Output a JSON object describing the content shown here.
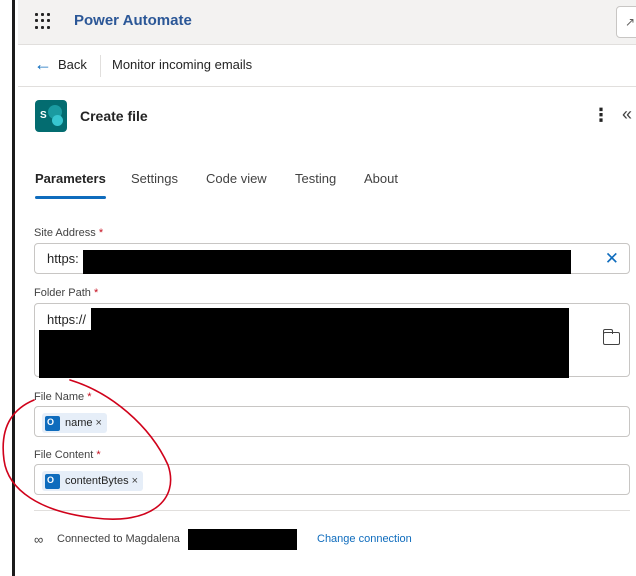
{
  "app": {
    "title": "Power Automate",
    "top_button_icon": "expand-icon"
  },
  "nav": {
    "back_label": "Back",
    "flow_name": "Monitor incoming emails"
  },
  "action": {
    "title": "Create file",
    "icon": "sharepoint-icon"
  },
  "tabs": [
    {
      "label": "Parameters",
      "active": true
    },
    {
      "label": "Settings"
    },
    {
      "label": "Code view"
    },
    {
      "label": "Testing"
    },
    {
      "label": "About"
    }
  ],
  "fields": {
    "site_address": {
      "label": "Site Address",
      "required": "*",
      "value": "https:"
    },
    "folder_path": {
      "label": "Folder Path",
      "required": "*",
      "value": "https://"
    },
    "file_name": {
      "label": "File Name",
      "required": "*",
      "token": "name",
      "token_remove": "×"
    },
    "file_content": {
      "label": "File Content",
      "required": "*",
      "token": "contentBytes",
      "token_remove": "×"
    }
  },
  "connection": {
    "text": "Connected to Magdalena",
    "change_label": "Change connection"
  },
  "colors": {
    "accent": "#0f6cbd",
    "brand_title": "#2b5797",
    "required": "#c50f1f",
    "annotation": "#d0021b"
  }
}
